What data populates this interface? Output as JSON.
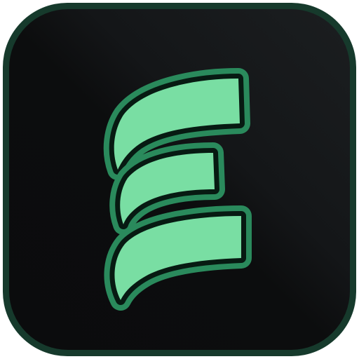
{
  "icon": {
    "name": "app-icon-e-logo",
    "colors": {
      "background_dark": "#0b0c0d",
      "background_sheen": "#1a1d1f",
      "border": "#163a2c",
      "logo_fill": "#79dea3",
      "logo_glow": "#2a8a5c",
      "logo_edge": "#071a12"
    }
  }
}
